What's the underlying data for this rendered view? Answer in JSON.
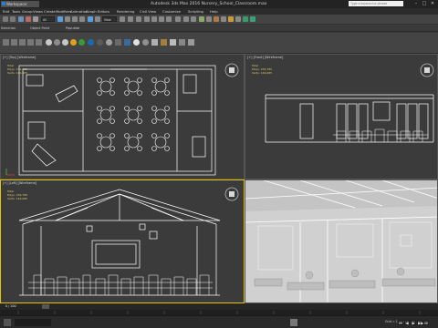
{
  "titlebar": {
    "workspace": "Workspace: Default",
    "app_title": "Autodesk 3ds Max 2016    Nursery_School_Classroom.max",
    "search_placeholder": "Type a keyword or phrase",
    "minimize": "–",
    "maximize": "□",
    "close": "✕"
  },
  "menus": [
    "Edit",
    "Tools",
    "Group",
    "Views",
    "Create",
    "Modifiers",
    "Animation",
    "Graph Editors",
    "Rendering",
    "Civil View",
    "Customize",
    "Scripting",
    "Help"
  ],
  "toolbar": {
    "selection_filter": "All",
    "view_dropdown": "View"
  },
  "ribbon_tabs": [
    "Selection",
    "Object Paint",
    "Populate"
  ],
  "viewports": {
    "top": {
      "label": "[+] [Top] [Wireframe]",
      "stats_label": "Total",
      "polys_label": "Polys:",
      "polys": "234,780",
      "verts_label": "Verts:",
      "verts": "146,085"
    },
    "front": {
      "label": "[+] [Front] [Wireframe]",
      "stats_label": "Total",
      "polys_label": "Polys:",
      "polys": "234,780",
      "verts_label": "Verts:",
      "verts": "146,085"
    },
    "left": {
      "label": "[+] [Left] [Wireframe]",
      "stats_label": "Total",
      "polys_label": "Polys:",
      "polys": "234,780",
      "verts_label": "Verts:",
      "verts": "146,085"
    },
    "perspective": {
      "label": ""
    }
  },
  "timeslider": {
    "frame": "0 / 100"
  },
  "statusbar": {
    "grid": "Grid = 10,0cm",
    "play_icons": [
      "⏮",
      "◀",
      "▶",
      "▶▶",
      "⏭"
    ]
  },
  "colors": {
    "active_viewport_border": "#e6c200",
    "wireframe": "#ffffff",
    "stats_text": "#d9c76a"
  }
}
